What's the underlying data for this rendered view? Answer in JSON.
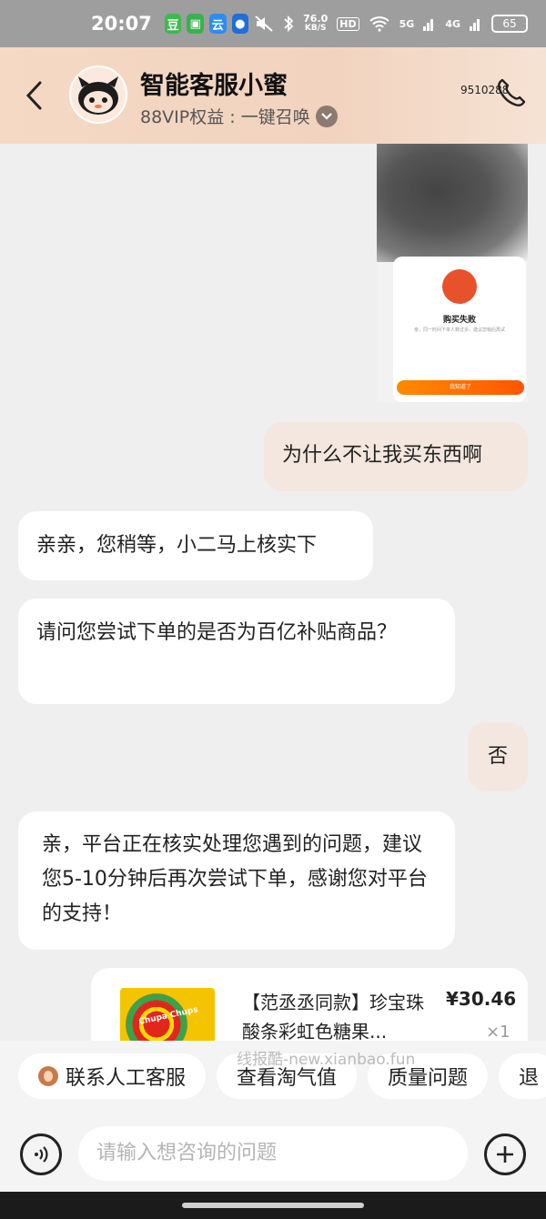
{
  "status_bar": {
    "time": "20:07",
    "app_icons": [
      {
        "name": "douban-icon",
        "glyph": "豆",
        "color": "#3dba4e"
      },
      {
        "name": "message-app-icon",
        "glyph": "▣",
        "color": "#37b24d"
      },
      {
        "name": "cloud-app-icon",
        "glyph": "云",
        "color": "#2d8cf0"
      },
      {
        "name": "bot-app-icon",
        "glyph": "●",
        "color": "#1e6fd9"
      }
    ],
    "net_speed_value": "76.0",
    "net_speed_unit": "KB/S",
    "hd_label": "HD",
    "sig1": "5G",
    "sig2": "4G",
    "battery": "65"
  },
  "header": {
    "title": "智能客服小蜜",
    "subtitle": "88VIP权益 : 一键召唤",
    "hotline": "9510288"
  },
  "screenshot_card": {
    "title": "购买失败",
    "description": "亲，同一时间下单人数过多，建议您稍后再试",
    "button": "我知道了"
  },
  "messages": [
    {
      "role": "user",
      "text": "为什么不让我买东西啊"
    },
    {
      "role": "bot",
      "text": "亲亲，您稍等，小二马上核实下"
    },
    {
      "role": "bot",
      "text": "请问您尝试下单的是否为百亿补贴商品？"
    },
    {
      "role": "user",
      "text": "否"
    },
    {
      "role": "bot",
      "text": "亲，平台正在核实处理您遇到的问题，建议您5-10分钟后再次尝试下单，感谢您对平台的支持！"
    }
  ],
  "product": {
    "brand_text": "Chupa Chups",
    "name": "【范丞丞同款】珍宝珠酸条彩虹色糖果...",
    "price": "¥30.46",
    "quantity": "×1"
  },
  "watermark": "线报酷-new.xianbao.fun",
  "quick_actions": [
    "联系人工客服",
    "查看淘气值",
    "质量问题",
    "退"
  ],
  "input": {
    "placeholder": "请输入想咨询的问题"
  },
  "colors": {
    "user_bubble": "#f3e7df",
    "bot_bubble": "#ffffff",
    "header_bg": "#f3d6c2",
    "accent_orange": "#ff6a00"
  }
}
